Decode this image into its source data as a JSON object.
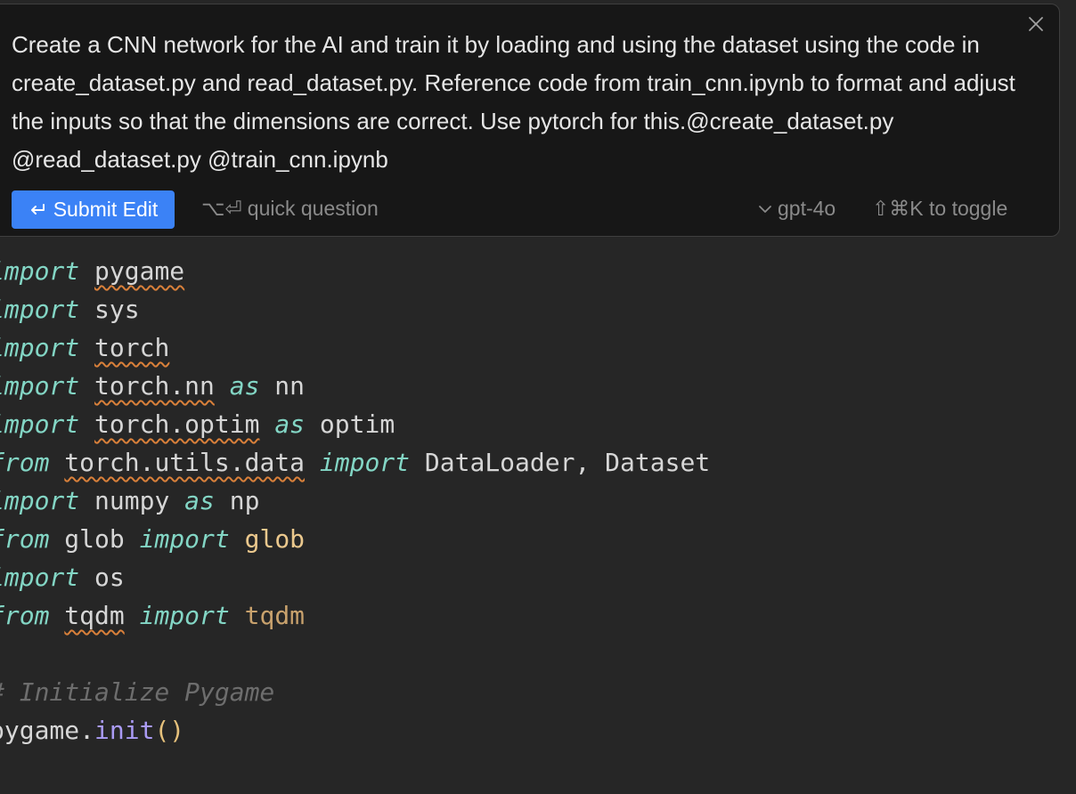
{
  "prompt": {
    "text": "Create a CNN network for the AI and train it by loading and using the dataset using the code in create_dataset.py and read_dataset.py. Reference code from train_cnn.ipynb to format and adjust the inputs so that the dimensions are correct. Use pytorch for this.@create_dataset.py @read_dataset.py @train_cnn.ipynb",
    "submit_label": "Submit Edit",
    "quick_question_shortcut": "⌥⏎",
    "quick_question_label": "quick question",
    "model": "gpt-4o",
    "toggle_hint": "⇧⌘K to toggle",
    "accent_color": "#3b82f6"
  },
  "code": {
    "lines": [
      "import pygame",
      "import sys",
      "import torch",
      "import torch.nn as nn",
      "import torch.optim as optim",
      "from torch.utils.data import DataLoader, Dataset",
      "import numpy as np",
      "from glob import glob",
      "import os",
      "from tqdm import tqdm",
      "",
      "# Initialize Pygame",
      "pygame.init()"
    ]
  }
}
